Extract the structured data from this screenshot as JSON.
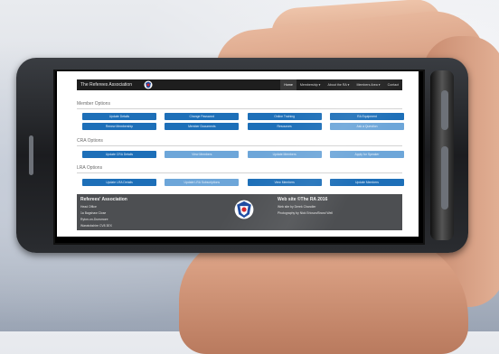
{
  "site": {
    "brand": "The Referees Association",
    "nav": [
      "Home",
      "Membership ▾",
      "About the RA ▾",
      "Members Area ▾",
      "Contact"
    ]
  },
  "sections": [
    {
      "title": "Member Options",
      "buttons": [
        {
          "label": "Update Details",
          "style": "dark"
        },
        {
          "label": "Change Password",
          "style": "dark"
        },
        {
          "label": "Online Training",
          "style": "dark"
        },
        {
          "label": "RA Equipment",
          "style": "dark"
        },
        {
          "label": "Renew Membership",
          "style": "dark"
        },
        {
          "label": "Member Documents",
          "style": "dark"
        },
        {
          "label": "Resources",
          "style": "dark"
        },
        {
          "label": "Ask a Question",
          "style": "light"
        }
      ]
    },
    {
      "title": "CRA Options",
      "buttons": [
        {
          "label": "Update CRA Details",
          "style": "dark"
        },
        {
          "label": "View Members",
          "style": "light"
        },
        {
          "label": "Update Members",
          "style": "light"
        },
        {
          "label": "Apply for Speaker",
          "style": "light"
        }
      ]
    },
    {
      "title": "LRA Options",
      "buttons": [
        {
          "label": "Update LRA Details",
          "style": "dark"
        },
        {
          "label": "Update LRA Subscriptions",
          "style": "light"
        },
        {
          "label": "View Members",
          "style": "dark"
        },
        {
          "label": "Update Members",
          "style": "dark"
        }
      ]
    }
  ],
  "footer": {
    "left_title": "Referees' Association",
    "left_lines": [
      "Head Office",
      "1a Bagshaw Close",
      "Ryton-on-Dunsmore",
      "Warwickshire CV8 3EX"
    ],
    "right_title": "Web site ©The RA 2016",
    "right_lines": [
      "Web site by Derek Chandler",
      "Photography by Nick Ericson/Brand Well"
    ]
  },
  "colors": {
    "button_dark": "#1d6fb8",
    "button_light": "#6da6d9",
    "nav_bg": "#1e1e1e",
    "footer_bg": "#4d4f52"
  }
}
